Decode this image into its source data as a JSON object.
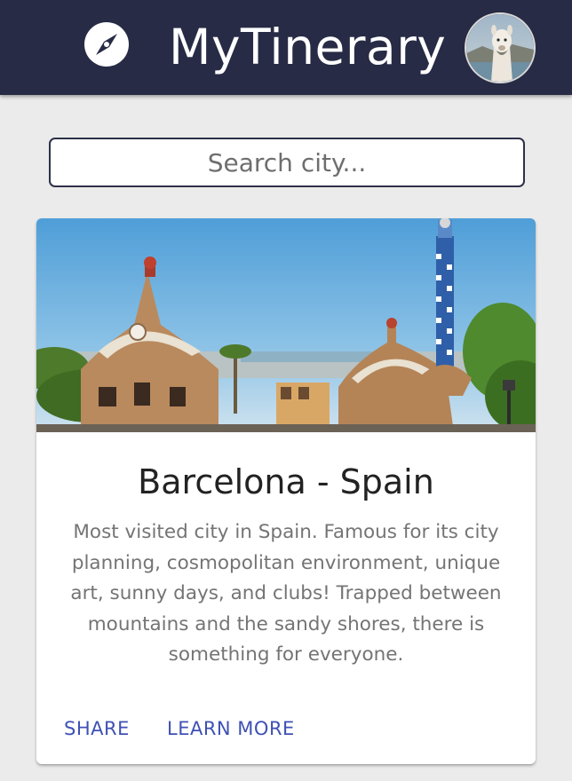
{
  "app": {
    "title": "MyTinerary",
    "compass_icon": "compass-icon",
    "avatar_icon": "user-avatar-alpaca"
  },
  "search": {
    "placeholder": "Search city..."
  },
  "city_card": {
    "title": "Barcelona - Spain",
    "description": "Most visited city in Spain. Famous for its city planning, cosmopolitan environment, unique art, sunny days, and clubs! Trapped between mountains and the sandy shores, there is something for everyone.",
    "image_icon": "barcelona-park-guell-photo",
    "actions": {
      "share_label": "SHARE",
      "learn_more_label": "LEARN MORE"
    }
  },
  "colors": {
    "appbar": "#272b45",
    "accent": "#3f51b5",
    "background": "#ebebeb"
  }
}
